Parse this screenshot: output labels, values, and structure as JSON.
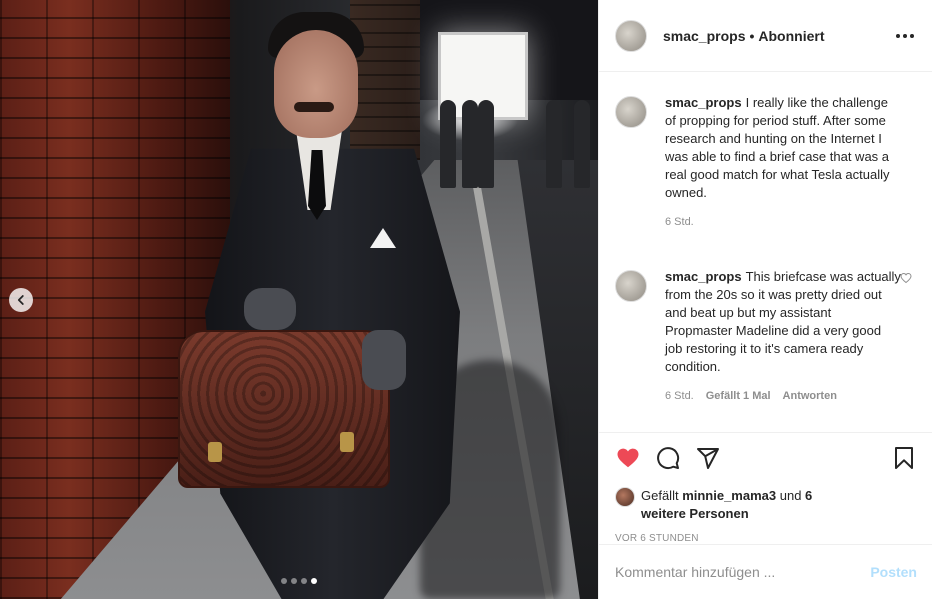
{
  "post": {
    "username": "smac_props",
    "separator": "•",
    "follow_status": "Abonniert",
    "photo": {
      "carousel_total": 4,
      "carousel_active_index": 4
    }
  },
  "comments": [
    {
      "username": "smac_props",
      "text": "I really like the challenge of propping for period stuff. After some research and hunting on the Internet I was able to find a brief case that was a real good match for what Tesla actually owned.",
      "time": "6 Std.",
      "likes": "",
      "reply": ""
    },
    {
      "username": "smac_props",
      "text": "This briefcase was actually from the 20s so it was pretty dried out and beat up but my assistant Propmaster Madeline did a very good job restoring it to it's camera ready condition.",
      "time": "6 Std.",
      "likes": "Gefällt 1 Mal",
      "reply": "Antworten"
    }
  ],
  "likes": {
    "prefix": "Gefällt ",
    "liker": "minnie_mama3",
    "middle": " und ",
    "others": "6 weitere Personen"
  },
  "timestamp": "VOR 6 STUNDEN",
  "comment_input": {
    "placeholder": "Kommentar hinzufügen ...",
    "post_label": "Posten"
  },
  "icons": {
    "like": "heart-icon",
    "comment": "comment-bubble-icon",
    "share": "paper-plane-icon",
    "save": "bookmark-icon",
    "more": "more-horizontal-icon",
    "prev": "chevron-left-icon"
  },
  "colors": {
    "liked_heart": "#ed4956",
    "text": "#262626",
    "secondary": "#8e8e8e",
    "post_disabled": "#b2dffc"
  }
}
